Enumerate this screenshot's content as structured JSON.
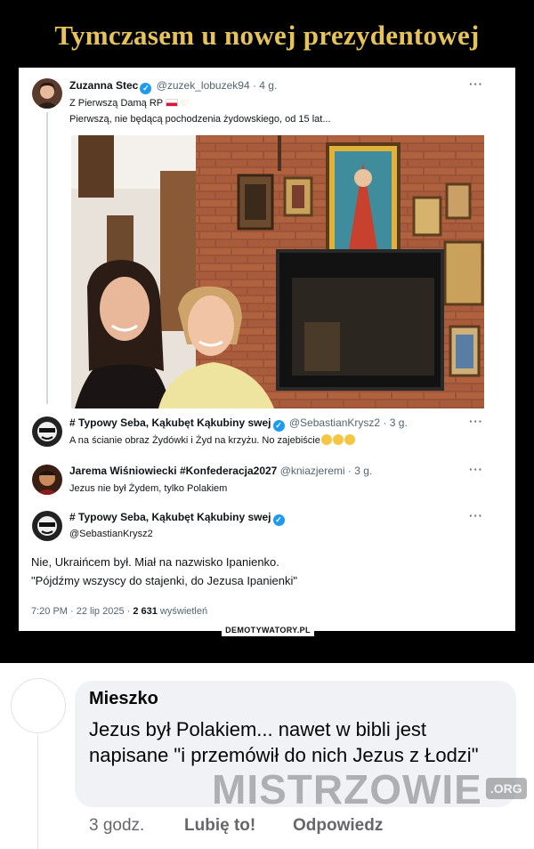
{
  "demot": {
    "title": "Tymczasem u nowej prezydentowej",
    "watermark": "DEMOTYWATORY.PL"
  },
  "tweets": [
    {
      "name": "Zuzanna Stec",
      "handle": "@zuzek_lobuzek94",
      "time": "4 g.",
      "line1": "Z Pierwszą Damą RP",
      "line2": "Pierwszą,  nie będącą pochodzenia żydowskiego, od 15 lat..."
    },
    {
      "name": "# Typowy Seba, Kąkubęt Kąkubiny swej",
      "handle": "@SebastianKrysz2",
      "time": "3 g.",
      "text": "A na ścianie obraz Żydówki i Żyd na krzyżu. No zajebiście"
    },
    {
      "name": "Jarema Wiśniowiecki #Konfederacja2027",
      "handle": "@kniazjeremi",
      "time": "3 g.",
      "text": "Jezus nie był Żydem, tylko Polakiem"
    },
    {
      "name": "# Typowy Seba, Kąkubęt Kąkubiny swej",
      "handle": "@SebastianKrysz2",
      "line1": "Nie, Ukraińcem był. Miał na nazwisko Ipanienko.",
      "line2": "\"Pójdźmy wszyscy do stajenki, do Jezusa Ipanienki\"",
      "meta_time": "7:20 PM · 22 lip 2025 · ",
      "views": "2 631",
      "views_label": " wyświetleń"
    }
  ],
  "more_label": "···",
  "dot": " · ",
  "comment": {
    "author": "Mieszko",
    "text": "Jezus był Polakiem... nawet w bibli jest napisane \"i przemówił do nich Jezus z Łodzi\"",
    "watermark": "MISTRZOWIE",
    "watermark_suffix": ".ORG",
    "time": "3 godz.",
    "like": "Lubię to!",
    "reply": "Odpowiedz"
  },
  "colors": {
    "title_gold": "#e6c35a",
    "verified_blue": "#1d9bf0",
    "bubble_bg": "#f0f2f5"
  }
}
